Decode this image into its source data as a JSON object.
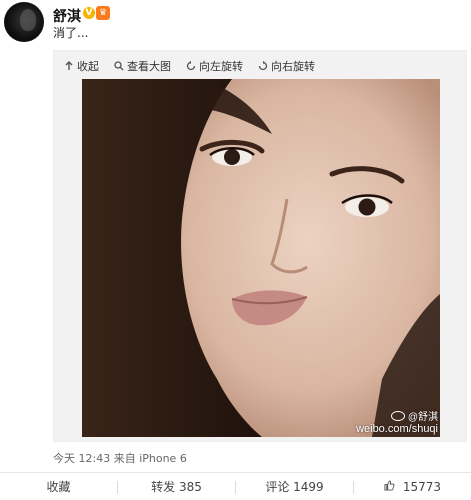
{
  "user": {
    "name": "舒淇",
    "verified_badge": "V",
    "crown_badge": "♛"
  },
  "post": {
    "text": "消了..."
  },
  "toolbar": {
    "collapse": "收起",
    "view_large": "查看大图",
    "rotate_left": "向左旋转",
    "rotate_right": "向右旋转"
  },
  "watermark": {
    "handle": "@舒淇",
    "url": "weibo.com/shuqi"
  },
  "meta": {
    "time": "今天 12:43 来自 iPhone 6"
  },
  "footer": {
    "favorite": "收藏",
    "repost": "转发 385",
    "comment": "评论 1499",
    "like": "15773"
  },
  "colors": {
    "accent": "#f7b500",
    "crown": "#ff7a1a",
    "link": "#333333"
  }
}
